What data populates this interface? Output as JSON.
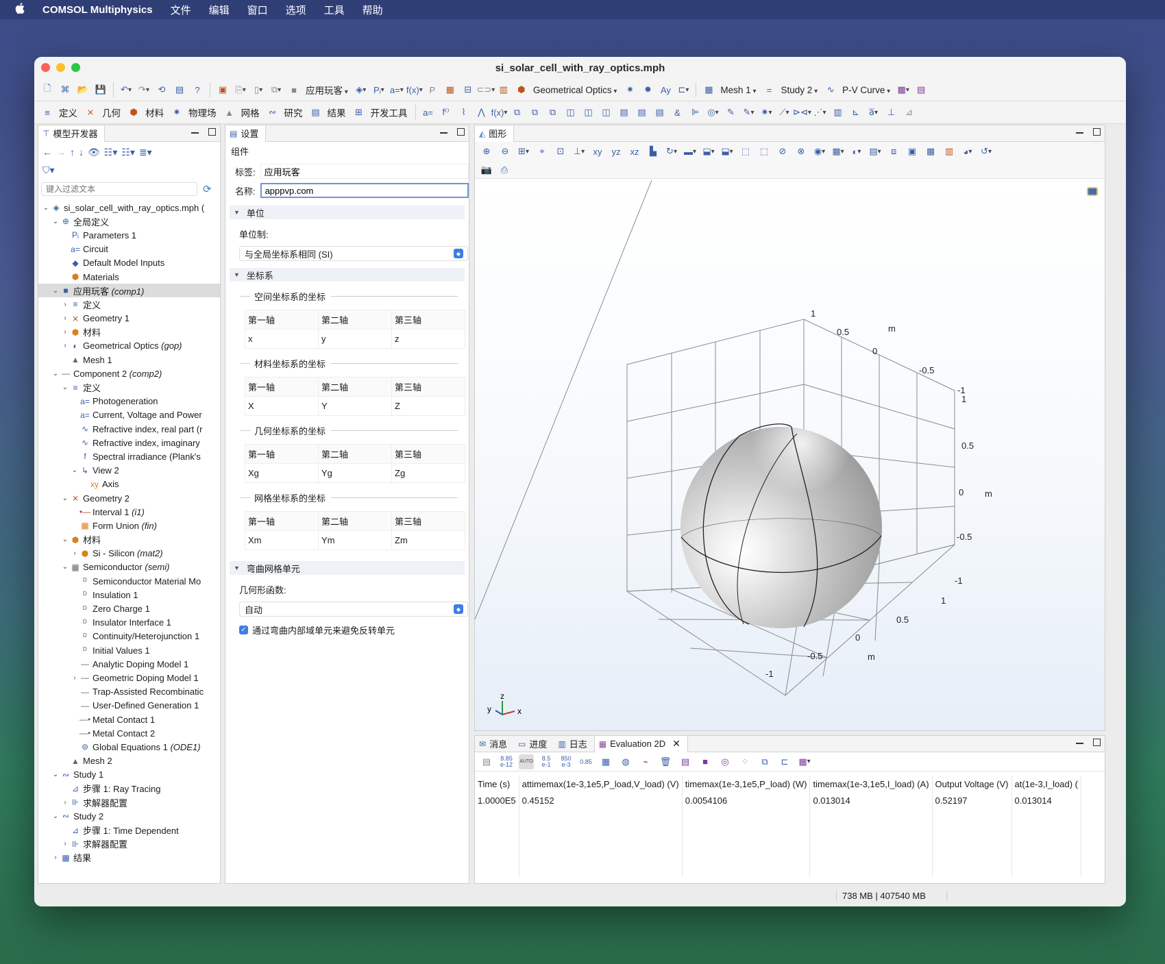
{
  "menubar": {
    "apple": "",
    "app": "COMSOL Multiphysics",
    "items": [
      "文件",
      "编辑",
      "窗口",
      "选项",
      "工具",
      "帮助"
    ]
  },
  "window": {
    "title": "si_solar_cell_with_ray_optics.mph"
  },
  "toolbar1": {
    "app_player": "应用玩客",
    "geometrical_optics": "Geometrical Optics",
    "mesh": "Mesh 1",
    "study": "Study 2",
    "pv_curve": "P-V Curve",
    "fx": "f(x)",
    "pi": "Pᵢ",
    "a_eq": "a="
  },
  "toolbar2": {
    "tabs": [
      "定义",
      "几何",
      "材料",
      "物理场",
      "网格",
      "研究",
      "结果",
      "开发工具"
    ],
    "fx": "f(x)",
    "a_eq": "a="
  },
  "tree_panel": {
    "title": "模型开发器",
    "filter_placeholder": "键入过滤文本",
    "items": [
      {
        "t": "▾",
        "icon": "◈",
        "c": "i-blue",
        "label": "si_solar_cell_with_ray_optics.mph (",
        "ind": 0,
        "name": "tree-root-file"
      },
      {
        "t": "▾",
        "icon": "⊕",
        "c": "i-blue",
        "label": "全局定义",
        "ind": 1,
        "name": "tree-global-definitions"
      },
      {
        "t": "",
        "icon": "Pᵢ",
        "c": "i-blue",
        "label": "Parameters 1",
        "ind": 2,
        "name": "tree-parameters"
      },
      {
        "t": "",
        "icon": "a=",
        "c": "i-blue",
        "label": "Circuit",
        "ind": 2,
        "name": "tree-circuit"
      },
      {
        "t": "",
        "icon": "◆",
        "c": "i-blue",
        "label": "Default Model Inputs",
        "ind": 2,
        "name": "tree-default-model-inputs"
      },
      {
        "t": "",
        "icon": "⬢",
        "c": "i-org",
        "label": "Materials",
        "ind": 2,
        "name": "tree-materials-global"
      },
      {
        "t": "▾",
        "icon": "■",
        "c": "i-blue",
        "label": "应用玩客 ",
        "em": "(comp1)",
        "ind": 1,
        "sel": true,
        "name": "tree-component-1"
      },
      {
        "t": "›",
        "icon": "≡",
        "c": "i-blue",
        "label": "定义",
        "ind": 2,
        "name": "tree-comp1-definitions"
      },
      {
        "t": "›",
        "icon": "⨯",
        "c": "i-red",
        "label": "Geometry 1",
        "ind": 2,
        "name": "tree-geometry-1"
      },
      {
        "t": "›",
        "icon": "⬢",
        "c": "i-org",
        "label": "材料",
        "ind": 2,
        "name": "tree-comp1-materials"
      },
      {
        "t": "›",
        "icon": "◐",
        "c": "i-blue",
        "label": "Geometrical Optics ",
        "em": "(gop)",
        "ind": 2,
        "name": "tree-geometrical-optics"
      },
      {
        "t": "",
        "icon": "▲",
        "c": "i-gray",
        "label": "Mesh 1",
        "ind": 2,
        "name": "tree-mesh-1"
      },
      {
        "t": "▾",
        "icon": "—",
        "c": "i-gray",
        "label": "Component 2 ",
        "em": "(comp2)",
        "ind": 1,
        "name": "tree-component-2"
      },
      {
        "t": "▾",
        "icon": "≡",
        "c": "i-blue",
        "label": "定义",
        "ind": 2,
        "name": "tree-comp2-definitions"
      },
      {
        "t": "",
        "icon": "a=",
        "c": "i-blue",
        "label": "Photogeneration",
        "ind": 3,
        "name": "tree-photogeneration"
      },
      {
        "t": "",
        "icon": "a=",
        "c": "i-blue",
        "label": "Current, Voltage  and Power",
        "ind": 3,
        "name": "tree-current-voltage-power"
      },
      {
        "t": "",
        "icon": "∿",
        "c": "i-blue",
        "label": "Refractive index, real part (r",
        "ind": 3,
        "name": "tree-refractive-real"
      },
      {
        "t": "",
        "icon": "∿",
        "c": "i-blue",
        "label": "Refractive index, imaginary",
        "ind": 3,
        "name": "tree-refractive-imaginary"
      },
      {
        "t": "",
        "icon": "f",
        "c": "i-blue",
        "label": "Spectral irradiance (Plank's",
        "ind": 3,
        "name": "tree-spectral-irradiance"
      },
      {
        "t": "▾",
        "icon": "↳",
        "c": "i-blue",
        "label": "View 2",
        "ind": 3,
        "name": "tree-view-2"
      },
      {
        "t": "",
        "icon": "xy",
        "c": "i-org",
        "label": "Axis",
        "ind": 4,
        "name": "tree-axis"
      },
      {
        "t": "▾",
        "icon": "⨯",
        "c": "i-red",
        "label": "Geometry 2",
        "ind": 2,
        "name": "tree-geometry-2"
      },
      {
        "t": "",
        "icon": "•—",
        "c": "i-red",
        "label": "Interval 1 ",
        "em": "(i1)",
        "ind": 3,
        "name": "tree-interval-1"
      },
      {
        "t": "",
        "icon": "▦",
        "c": "i-org",
        "label": "Form Union ",
        "em": "(fin)",
        "ind": 3,
        "name": "tree-form-union"
      },
      {
        "t": "▾",
        "icon": "⬢",
        "c": "i-org",
        "label": "材料",
        "ind": 2,
        "name": "tree-comp2-materials"
      },
      {
        "t": "›",
        "icon": "⬢",
        "c": "i-org",
        "label": "Si - Silicon ",
        "em": "(mat2)",
        "ind": 3,
        "name": "tree-silicon"
      },
      {
        "t": "▾",
        "icon": "▦",
        "c": "i-gray",
        "label": "Semiconductor ",
        "em": "(semi)",
        "ind": 2,
        "name": "tree-semiconductor"
      },
      {
        "t": "",
        "icon": "ᴰ",
        "c": "i-gray",
        "label": "Semiconductor Material Mo",
        "ind": 3,
        "name": "tree-semiconductor-material"
      },
      {
        "t": "",
        "icon": "ᴰ",
        "c": "i-gray",
        "label": "Insulation 1",
        "ind": 3,
        "name": "tree-insulation"
      },
      {
        "t": "",
        "icon": "ᴰ",
        "c": "i-gray",
        "label": "Zero Charge 1",
        "ind": 3,
        "name": "tree-zero-charge"
      },
      {
        "t": "",
        "icon": "ᴰ",
        "c": "i-gray",
        "label": "Insulator Interface 1",
        "ind": 3,
        "name": "tree-insulator-interface"
      },
      {
        "t": "",
        "icon": "ᴰ",
        "c": "i-gray",
        "label": "Continuity/Heterojunction 1",
        "ind": 3,
        "name": "tree-continuity"
      },
      {
        "t": "",
        "icon": "ᴰ",
        "c": "i-gray",
        "label": "Initial Values 1",
        "ind": 3,
        "name": "tree-initial-values"
      },
      {
        "t": "",
        "icon": "—",
        "c": "i-gray",
        "label": "Analytic Doping Model 1",
        "ind": 3,
        "name": "tree-analytic-doping"
      },
      {
        "t": "›",
        "icon": "—",
        "c": "i-gray",
        "label": "Geometric Doping Model 1",
        "ind": 3,
        "name": "tree-geometric-doping"
      },
      {
        "t": "",
        "icon": "—",
        "c": "i-gray",
        "label": "Trap-Assisted Recombinatic",
        "ind": 3,
        "name": "tree-trap-assisted"
      },
      {
        "t": "",
        "icon": "—",
        "c": "i-gray",
        "label": "User-Defined Generation 1",
        "ind": 3,
        "name": "tree-user-generation"
      },
      {
        "t": "",
        "icon": "—•",
        "c": "i-gray",
        "label": "Metal Contact 1",
        "ind": 3,
        "name": "tree-metal-contact-1"
      },
      {
        "t": "",
        "icon": "—•",
        "c": "i-gray",
        "label": "Metal Contact 2",
        "ind": 3,
        "name": "tree-metal-contact-2"
      },
      {
        "t": "",
        "icon": "⊚",
        "c": "i-blue",
        "label": "Global Equations 1 ",
        "em": "(ODE1)",
        "ind": 3,
        "name": "tree-global-equations"
      },
      {
        "t": "",
        "icon": "▲",
        "c": "i-gray",
        "label": "Mesh 2",
        "ind": 2,
        "name": "tree-mesh-2"
      },
      {
        "t": "▾",
        "icon": "∾",
        "c": "i-blue",
        "label": "Study 1",
        "ind": 1,
        "name": "tree-study-1"
      },
      {
        "t": "",
        "icon": "⊿",
        "c": "i-blue",
        "label": "步骤 1: Ray Tracing",
        "ind": 2,
        "name": "tree-step-ray-tracing"
      },
      {
        "t": "›",
        "icon": "⊪",
        "c": "i-blue",
        "label": "求解器配置",
        "ind": 2,
        "name": "tree-solver-config-1"
      },
      {
        "t": "▾",
        "icon": "∾",
        "c": "i-blue",
        "label": "Study 2",
        "ind": 1,
        "name": "tree-study-2"
      },
      {
        "t": "",
        "icon": "⊿",
        "c": "i-blue",
        "label": "步骤 1: Time Dependent",
        "ind": 2,
        "name": "tree-step-time-dependent"
      },
      {
        "t": "›",
        "icon": "⊪",
        "c": "i-blue",
        "label": "求解器配置",
        "ind": 2,
        "name": "tree-solver-config-2"
      },
      {
        "t": "›",
        "icon": "▩",
        "c": "i-blue",
        "label": "结果",
        "ind": 1,
        "name": "tree-results"
      }
    ]
  },
  "settings": {
    "title": "设置",
    "subtitle": "组件",
    "label_label": "标签:",
    "label_value": "应用玩客",
    "name_label": "名称:",
    "name_value": "apppvp.com",
    "units_section": "单位",
    "unit_system_label": "单位制:",
    "unit_system_value": "与全局坐标系相同 (SI)",
    "coord_section": "坐标系",
    "curved_section": "弯曲网格单元",
    "geom_shape_label": "几何形函数:",
    "geom_shape_value": "自动",
    "checkbox_label": "通过弯曲内部域单元来避免反转单元",
    "coord_groups": [
      {
        "title": "空间坐标系的坐标",
        "headers": [
          "第一轴",
          "第二轴",
          "第三轴"
        ],
        "values": [
          "x",
          "y",
          "z"
        ]
      },
      {
        "title": "材料坐标系的坐标",
        "headers": [
          "第一轴",
          "第二轴",
          "第三轴"
        ],
        "values": [
          "X",
          "Y",
          "Z"
        ]
      },
      {
        "title": "几何坐标系的坐标",
        "headers": [
          "第一轴",
          "第二轴",
          "第三轴"
        ],
        "values": [
          "Xg",
          "Yg",
          "Zg"
        ]
      },
      {
        "title": "网格坐标系的坐标",
        "headers": [
          "第一轴",
          "第二轴",
          "第三轴"
        ],
        "values": [
          "Xm",
          "Ym",
          "Zm"
        ]
      }
    ]
  },
  "graphics": {
    "title": "图形",
    "axis_labels": {
      "top": [
        "1",
        "0.5",
        "0",
        "-0.5",
        "-1"
      ],
      "top_unit": "m",
      "right": [
        "1",
        "0.5",
        "0",
        "-0.5",
        "-1"
      ],
      "right_unit": "m",
      "bottom": [
        "1",
        "0.5",
        "0",
        "-0.5",
        "-1"
      ],
      "bottom_unit": "m"
    },
    "triad": {
      "x": "x",
      "y": "y",
      "z": "z"
    }
  },
  "bottom": {
    "tabs": [
      "消息",
      "进度",
      "日志",
      "Evaluation 2D"
    ],
    "tool_labels": {
      "a": "8.85",
      "a2": "e-12",
      "auto": "AUTO",
      "b": "8.5",
      "b2": "e-1",
      "c": "850",
      "c2": "e-3",
      "d": "0.85"
    },
    "table": {
      "headers": [
        "Time (s)",
        "attimemax(1e-3,1e5,P_load,V_load) (V)",
        "timemax(1e-3,1e5,P_load) (W)",
        "timemax(1e-3,1e5,I_load) (A)",
        "Output Voltage (V)",
        "at(1e-3,I_load) ("
      ],
      "rows": [
        [
          "1.0000E5",
          "0.45152",
          "0.0054106",
          "0.013014",
          "0.52197",
          "0.013014"
        ]
      ]
    }
  },
  "status": {
    "memory": "738 MB | 407540 MB"
  }
}
